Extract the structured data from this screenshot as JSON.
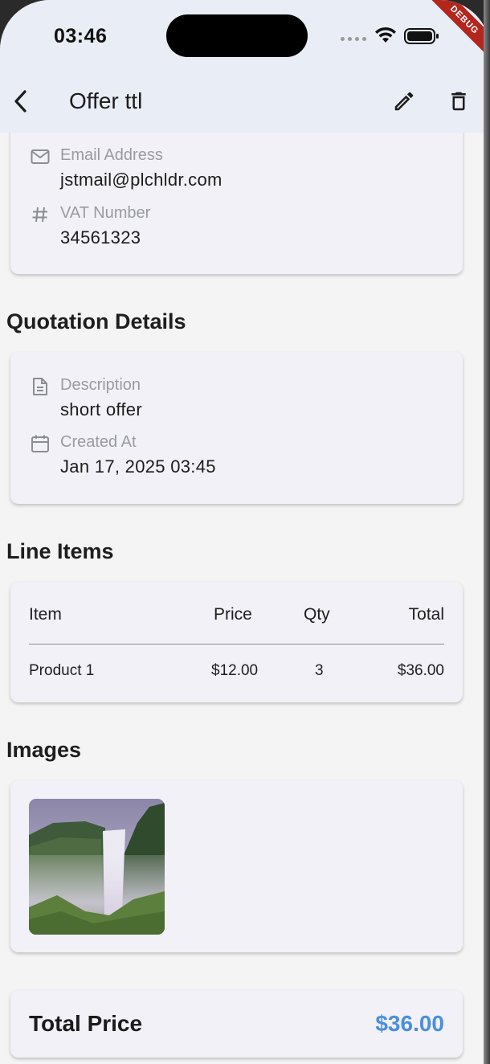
{
  "status_bar": {
    "time": "03:46"
  },
  "debug_banner": "DEBUG",
  "app_bar": {
    "title": "Offer ttl"
  },
  "client_card": {
    "email": {
      "label": "Email Address",
      "value": "jstmail@plchldr.com",
      "icon": "mail-icon"
    },
    "vat": {
      "label": "VAT Number",
      "value": "34561323",
      "icon": "hash-icon"
    }
  },
  "quotation": {
    "title": "Quotation Details",
    "description": {
      "label": "Description",
      "value": "short offer",
      "icon": "document-icon"
    },
    "created": {
      "label": "Created At",
      "value": "Jan 17, 2025 03:45",
      "icon": "calendar-icon"
    }
  },
  "line_items": {
    "title": "Line Items",
    "headers": {
      "item": "Item",
      "price": "Price",
      "qty": "Qty",
      "total": "Total"
    },
    "rows": [
      {
        "item": "Product 1",
        "price": "$12.00",
        "qty": "3",
        "total": "$36.00"
      }
    ]
  },
  "images": {
    "title": "Images",
    "thumbnail": "waterfall-photo"
  },
  "total": {
    "label": "Total Price",
    "value": "$36.00"
  },
  "colors": {
    "accent": "#4a8fdc",
    "app_bar_bg": "#e8edf6",
    "card_bg": "#f1f1f7",
    "debug": "#b3261e"
  }
}
